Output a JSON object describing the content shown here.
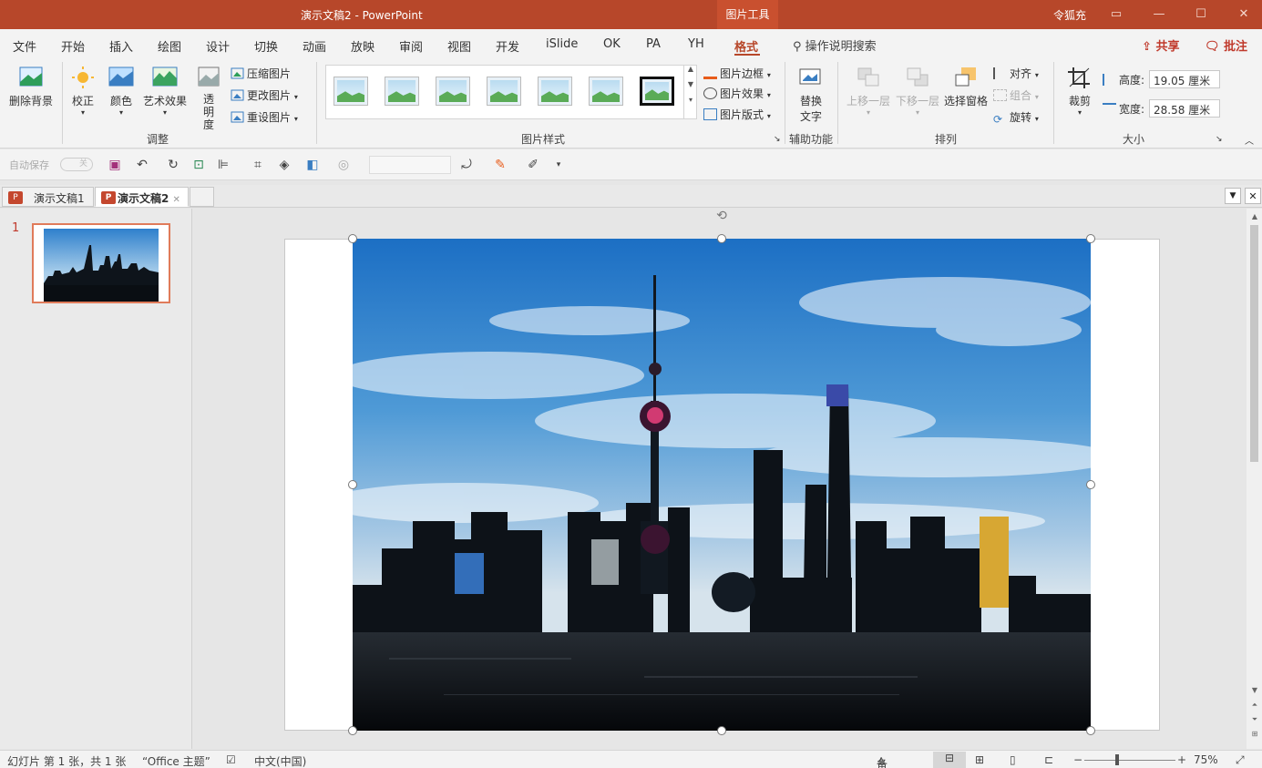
{
  "window": {
    "doc_title": "演示文稿2  -  PowerPoint",
    "context_tab": "图片工具",
    "user": "令狐充"
  },
  "tabs": [
    "文件",
    "开始",
    "插入",
    "绘图",
    "设计",
    "切换",
    "动画",
    "放映",
    "审阅",
    "视图",
    "开发",
    "iSlide",
    "OK",
    "PA",
    "YH",
    "格式"
  ],
  "search_placeholder": "操作说明搜索",
  "share": "共享",
  "comments": "批注",
  "ribbon": {
    "remove_bg": "删除背景",
    "corrections": "校正",
    "color": "颜色",
    "artistic": "艺术效果",
    "transparency": "透明度",
    "compress": "压缩图片",
    "change_picture": "更改图片",
    "reset_picture": "重设图片",
    "group_adjust": "调整",
    "group_styles": "图片样式",
    "border": "图片边框",
    "effects": "图片效果",
    "layout": "图片版式",
    "alt_text_1": "替换",
    "alt_text_2": "文字",
    "group_access": "辅助功能",
    "bring_forward": "上移一层",
    "send_backward": "下移一层",
    "selection_pane": "选择窗格",
    "align": "对齐",
    "group_obj": "组合",
    "rotate": "旋转",
    "group_arrange": "排列",
    "crop": "裁剪",
    "height_label": "高度:",
    "height_value": "19.05 厘米",
    "width_label": "宽度:",
    "width_value": "28.58 厘米",
    "group_size": "大小"
  },
  "qat": {
    "autosave": "自动保存",
    "autosave_state": "关"
  },
  "doc_tabs": [
    {
      "label": "演示文稿1"
    },
    {
      "label": "演示文稿2"
    }
  ],
  "slides": {
    "number": "1"
  },
  "status": {
    "slide": "幻灯片 第 1 张，共 1 张",
    "theme": "“Office 主题”",
    "lang": "中文(中国)",
    "notes": "备注",
    "zoom": "75%"
  },
  "colors": {
    "accent": "#b7472a",
    "selection": "#e07b5a"
  }
}
